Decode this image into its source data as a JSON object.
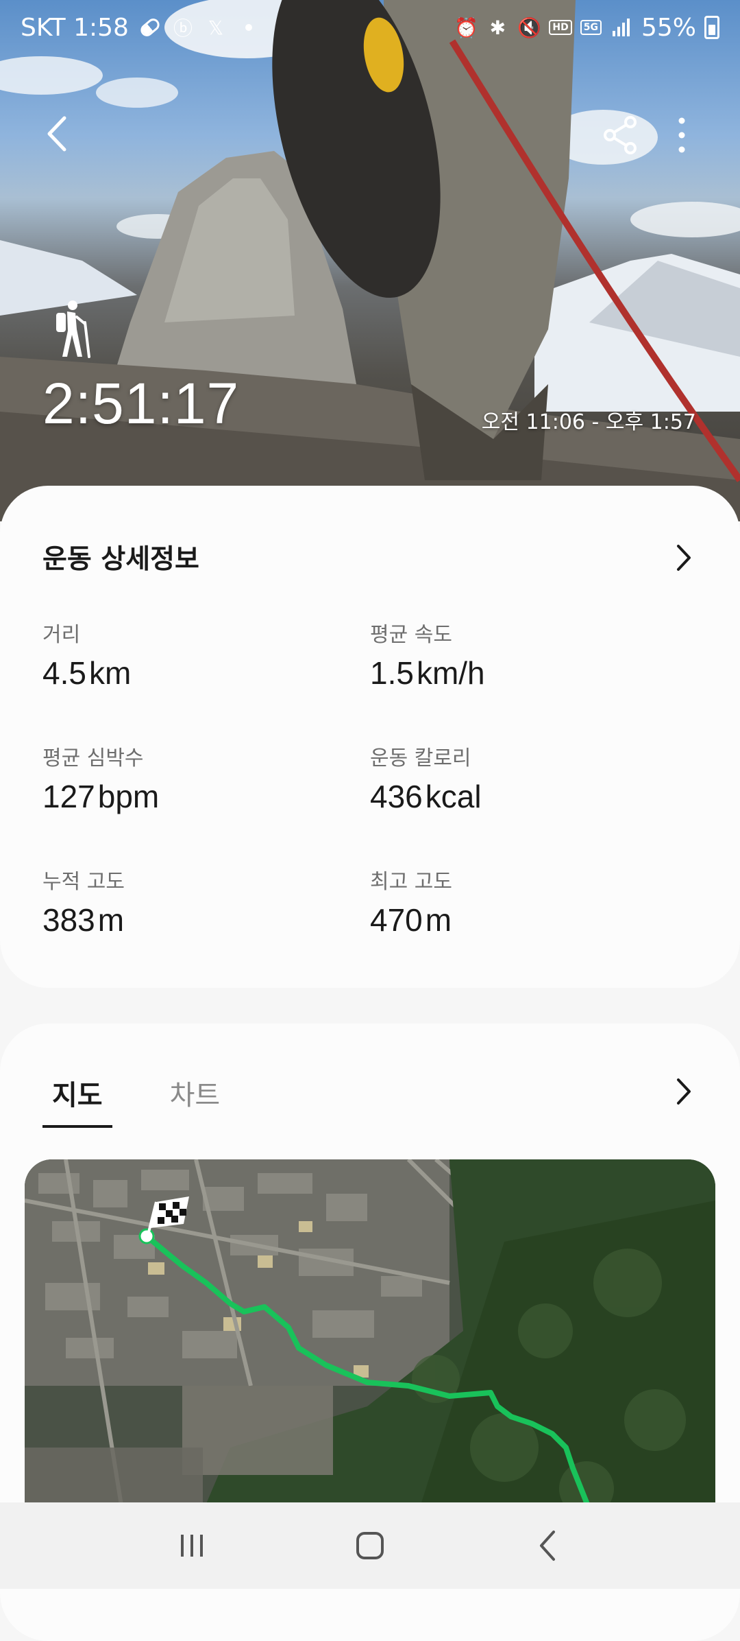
{
  "status_bar": {
    "carrier_time": "SKT 1:58",
    "battery": "55%",
    "icons": [
      "pill-icon",
      "b-app-icon",
      "x-icon",
      "dot-icon",
      "alarm-icon",
      "bluetooth-icon",
      "mute-icon",
      "hd-voice-icon",
      "5g-icon",
      "signal-icon",
      "battery-icon"
    ],
    "hd_badge": "HD",
    "fiveg_badge": "5G"
  },
  "hero": {
    "activity_icon": "hiking-icon",
    "duration": "2:51:17",
    "time_range": "오전 11:06 - 오후 1:57"
  },
  "details": {
    "title": "운동 상세정보",
    "metrics": [
      {
        "label": "거리",
        "value": "4.5",
        "unit": "km"
      },
      {
        "label": "평균 속도",
        "value": "1.5",
        "unit": "km/h"
      },
      {
        "label": "평균 심박수",
        "value": "127",
        "unit": "bpm"
      },
      {
        "label": "운동 칼로리",
        "value": "436",
        "unit": "kcal"
      },
      {
        "label": "누적 고도",
        "value": "383",
        "unit": "m"
      },
      {
        "label": "최고 고도",
        "value": "470",
        "unit": "m"
      }
    ]
  },
  "map_section": {
    "tabs": [
      {
        "label": "지도",
        "active": true
      },
      {
        "label": "차트",
        "active": false
      }
    ],
    "route_color": "#19c25a"
  },
  "colors": {
    "card_bg": "#fcfcfc",
    "page_bg": "#f6f6f6",
    "text_primary": "#1a1a1a",
    "text_secondary": "#6e6e6e"
  }
}
